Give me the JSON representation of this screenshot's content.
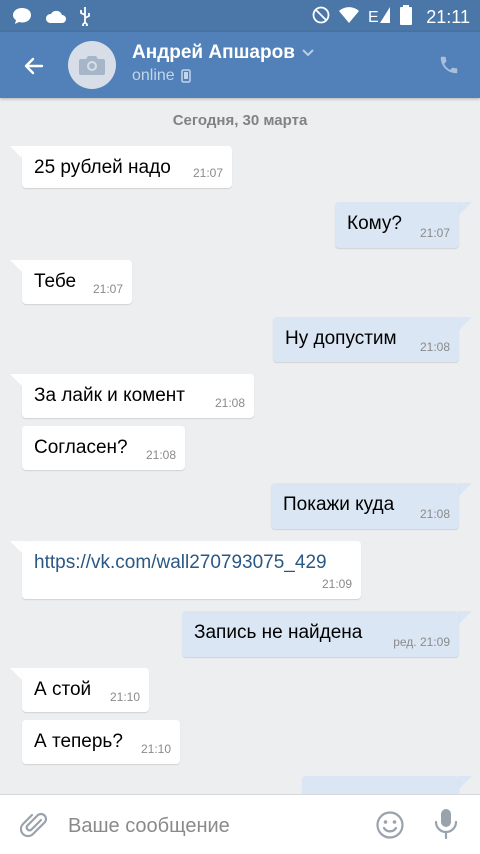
{
  "statusbar": {
    "time": "21:11"
  },
  "header": {
    "name": "Андрей Апшаров",
    "status": "online"
  },
  "date_separator": "Сегодня, 30 марта",
  "messages": [
    {
      "dir": "in",
      "text": "25 рублей надо",
      "time": "21:07"
    },
    {
      "dir": "out",
      "text": "Кому?",
      "time": "21:07"
    },
    {
      "dir": "in",
      "text": "Тебе",
      "time": "21:07"
    },
    {
      "dir": "out",
      "text": "Ну допустим",
      "time": "21:08"
    },
    {
      "dir": "in",
      "text": "За лайк и комент",
      "time": "21:08"
    },
    {
      "dir": "in",
      "text": "Согласен?",
      "time": "21:08"
    },
    {
      "dir": "out",
      "text": "Покажи куда",
      "time": "21:08"
    },
    {
      "dir": "in",
      "text": "https://vk.com/wall270793075_429",
      "time": "21:09"
    },
    {
      "dir": "out",
      "text": "Запись не найдена",
      "time": "ред. 21:09"
    },
    {
      "dir": "in",
      "text": "А стой",
      "time": "21:10"
    },
    {
      "dir": "in",
      "text": "А теперь?",
      "time": "21:10"
    }
  ],
  "composer": {
    "placeholder": "Ваше сообщение"
  },
  "colors": {
    "toolbar": "#5181b8",
    "statusbar": "#4a76a8",
    "bubble_out": "#dbe6f4",
    "link": "#2a5885"
  }
}
